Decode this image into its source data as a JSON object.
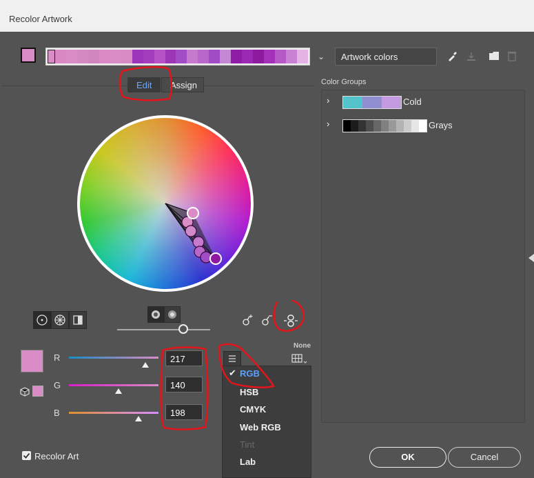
{
  "window": {
    "title": "Recolor Artwork"
  },
  "toolbar": {
    "artwork_dropdown": "Artwork colors",
    "harmony_colors": [
      "#d98cc6",
      "#d988c4",
      "#d98cc6",
      "#d589c2",
      "#cf85be",
      "#d989c6",
      "#d98cc6",
      "#d88ac5",
      "#9c35b7",
      "#a43cbe",
      "#b552c6",
      "#9c35b6",
      "#a24dc4",
      "#c57ad0",
      "#b968c9",
      "#a14cc4",
      "#c487d2",
      "#8f1ea7",
      "#9a2ab4",
      "#8d1a9f",
      "#a531b9",
      "#b658c6",
      "#ca80d5",
      "#e5b3e6"
    ]
  },
  "tabs": {
    "edit": "Edit",
    "assign": "Assign"
  },
  "color_groups": {
    "heading": "Color Groups",
    "groups": [
      {
        "name": "Cold",
        "colors": [
          "#55c3cc",
          "#8f8fd1",
          "#c49ae0"
        ]
      },
      {
        "name": "Grays",
        "colors": [
          "#000000",
          "#1c1c1c",
          "#333333",
          "#4d4d4d",
          "#666666",
          "#808080",
          "#999999",
          "#b3b3b3",
          "#cccccc",
          "#e6e6e6",
          "#ffffff"
        ]
      }
    ]
  },
  "sliders": {
    "r": {
      "label": "R",
      "value": "217",
      "fraction": 0.85
    },
    "g": {
      "label": "G",
      "value": "140",
      "fraction": 0.55
    },
    "b": {
      "label": "B",
      "value": "198",
      "fraction": 0.78
    }
  },
  "current_color": "#d98cc6",
  "none_label": "None",
  "mode_menu": {
    "items": [
      {
        "label": "RGB",
        "checked": true,
        "enabled": true
      },
      {
        "label": "HSB",
        "checked": false,
        "enabled": true
      },
      {
        "label": "CMYK",
        "checked": false,
        "enabled": true
      },
      {
        "label": "Web RGB",
        "checked": false,
        "enabled": true
      },
      {
        "label": "Tint",
        "checked": false,
        "enabled": false
      },
      {
        "label": "Lab",
        "checked": false,
        "enabled": true
      }
    ]
  },
  "footer": {
    "recolor_art": "Recolor Art",
    "recolor_art_checked": true,
    "ok": "OK",
    "cancel": "Cancel"
  }
}
